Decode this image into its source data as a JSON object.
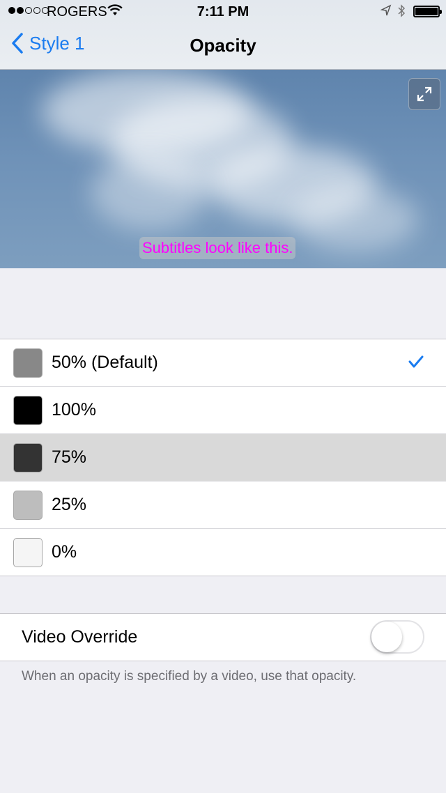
{
  "status_bar": {
    "carrier": "ROGERS",
    "time": "7:11 PM",
    "signal_bars_filled": 2,
    "signal_bars_total": 5
  },
  "nav": {
    "back_label": "Style 1",
    "title": "Opacity"
  },
  "preview": {
    "subtitle_text": "Subtitles look like this.",
    "subtitle_color": "#ff00ff"
  },
  "opacity_options": [
    {
      "label": "50% (Default)",
      "swatch_color": "#888888",
      "checked": true,
      "highlighted": false
    },
    {
      "label": "100%",
      "swatch_color": "#000000",
      "checked": false,
      "highlighted": false
    },
    {
      "label": "75%",
      "swatch_color": "#333333",
      "checked": false,
      "highlighted": true
    },
    {
      "label": "25%",
      "swatch_color": "#bdbdbd",
      "checked": false,
      "highlighted": false
    },
    {
      "label": "0%",
      "swatch_color": "#f5f5f5",
      "checked": false,
      "highlighted": false
    }
  ],
  "video_override": {
    "label": "Video Override",
    "enabled": false,
    "footnote": "When an opacity is specified by a video, use that opacity."
  },
  "colors": {
    "accent": "#1a7cf0",
    "background": "#efeff4"
  }
}
